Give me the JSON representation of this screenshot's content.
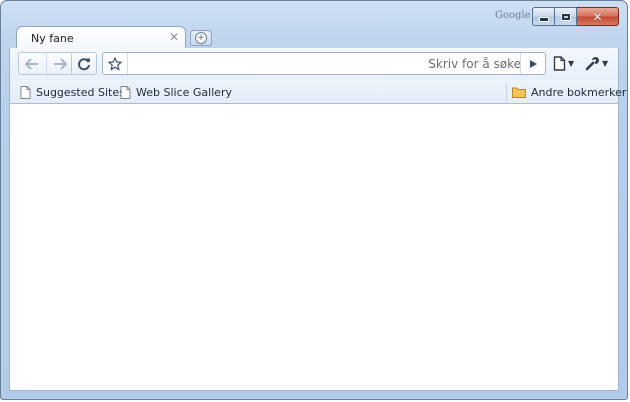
{
  "window": {
    "brand": "Google",
    "controls": {
      "minimize": "minimize",
      "maximize": "maximize",
      "close": "close"
    }
  },
  "tabs": [
    {
      "title": "Ny fane",
      "active": true
    }
  ],
  "toolbar": {
    "back": "back-arrow",
    "forward": "forward-arrow",
    "reload": "reload",
    "omnibox": {
      "value": "",
      "placeholder": "Skriv for å søke"
    }
  },
  "bookmarks_bar": {
    "items": [
      {
        "label": "Suggested Sites"
      },
      {
        "label": "Web Slice Gallery"
      }
    ],
    "other_bookmarks": "Andre bokmerker"
  },
  "colors": {
    "frame": "#b9d1ec",
    "folder": "#e9b94e",
    "close_button": "#c9503a"
  }
}
